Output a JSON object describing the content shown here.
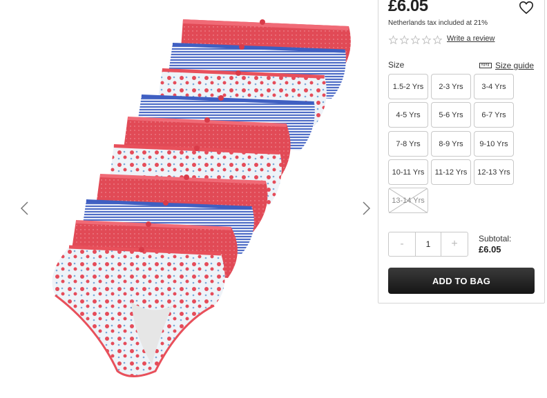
{
  "gallery": {
    "prev_icon": "chevron-left-icon",
    "next_icon": "chevron-right-icon",
    "image_alt": "multipack girls briefs"
  },
  "product": {
    "price": "£6.05",
    "tax_note": "Netherlands tax included at 21%",
    "rating_stars": 0,
    "review_link": "Write a review",
    "wishlist_icon": "heart-icon"
  },
  "size": {
    "label": "Size",
    "guide_label": "Size guide",
    "options": [
      {
        "label": "1.5-2 Yrs",
        "available": true
      },
      {
        "label": "2-3 Yrs",
        "available": true
      },
      {
        "label": "3-4 Yrs",
        "available": true
      },
      {
        "label": "4-5 Yrs",
        "available": true
      },
      {
        "label": "5-6 Yrs",
        "available": true
      },
      {
        "label": "6-7 Yrs",
        "available": true
      },
      {
        "label": "7-8 Yrs",
        "available": true
      },
      {
        "label": "8-9 Yrs",
        "available": true
      },
      {
        "label": "9-10 Yrs",
        "available": true
      },
      {
        "label": "10-11 Yrs",
        "available": true
      },
      {
        "label": "11-12 Yrs",
        "available": true
      },
      {
        "label": "12-13 Yrs",
        "available": true
      },
      {
        "label": "13-14 Yrs",
        "available": false
      }
    ]
  },
  "quantity": {
    "minus": "-",
    "value": "1",
    "plus": "+"
  },
  "subtotal": {
    "label": "Subtotal:",
    "value": "£6.05"
  },
  "cart": {
    "add_label": "ADD TO BAG"
  },
  "colors": {
    "red": "#e8505b",
    "blue": "#4f6fc9",
    "button": "#222222"
  }
}
